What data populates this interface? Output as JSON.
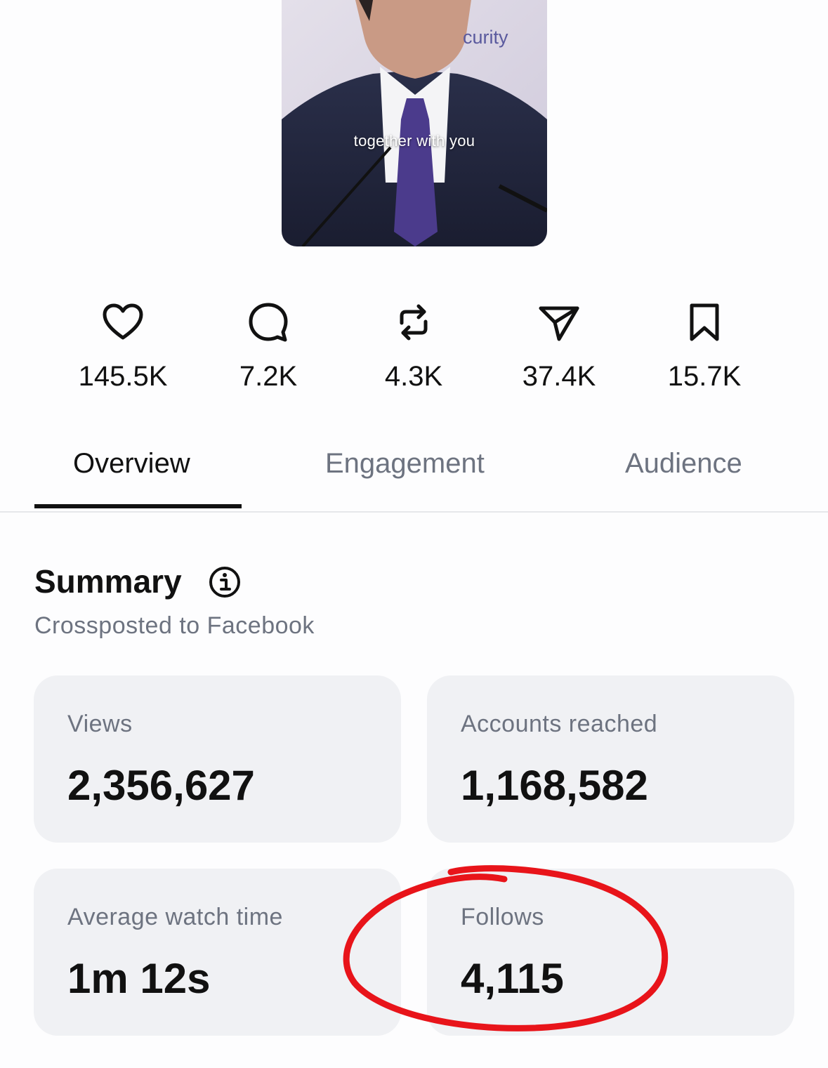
{
  "video": {
    "caption": "together with you",
    "background_text": "curity"
  },
  "stats": [
    {
      "icon": "heart-icon",
      "value": "145.5K"
    },
    {
      "icon": "comment-icon",
      "value": "7.2K"
    },
    {
      "icon": "repost-icon",
      "value": "4.3K"
    },
    {
      "icon": "share-icon",
      "value": "37.4K"
    },
    {
      "icon": "bookmark-icon",
      "value": "15.7K"
    }
  ],
  "tabs": [
    {
      "label": "Overview",
      "active": true
    },
    {
      "label": "Engagement",
      "active": false
    },
    {
      "label": "Audience",
      "active": false
    }
  ],
  "summary": {
    "title": "Summary",
    "subtitle": "Crossposted to Facebook",
    "cards": [
      {
        "label": "Views",
        "value": "2,356,627"
      },
      {
        "label": "Accounts reached",
        "value": "1,168,582"
      },
      {
        "label": "Average watch time",
        "value": "1m 12s"
      },
      {
        "label": "Follows",
        "value": "4,115"
      }
    ]
  },
  "colors": {
    "text_primary": "#111111",
    "text_secondary": "#6d7380",
    "card_bg": "#f0f1f4",
    "annotation": "#e8141a"
  }
}
